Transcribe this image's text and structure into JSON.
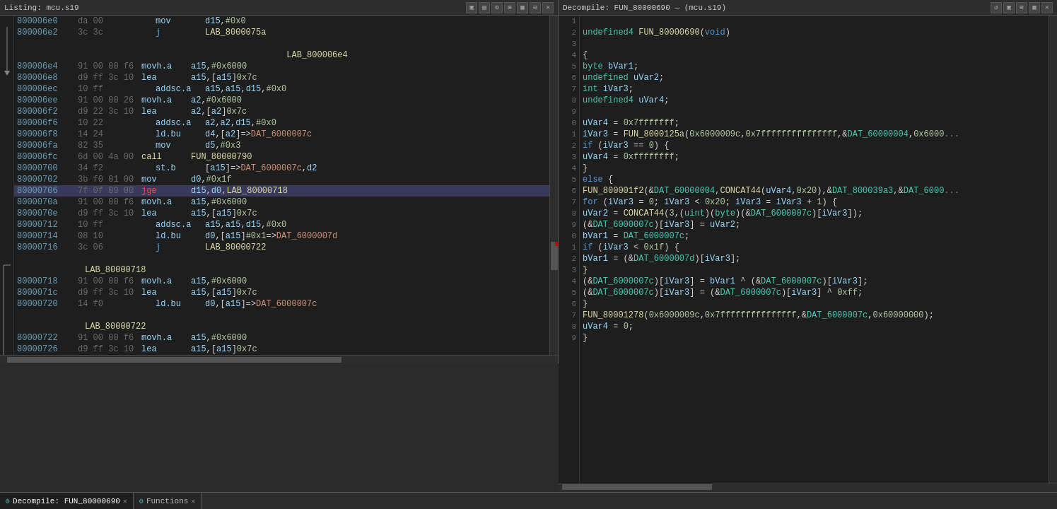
{
  "leftPanel": {
    "title": "Listing: mcu.s19",
    "lines": [
      {
        "addr": "800006e0",
        "bytes": "da 00",
        "mnem": "mov",
        "operands": "d15,#0x0",
        "type": "normal"
      },
      {
        "addr": "800006e2",
        "bytes": "3c 3c",
        "mnem": "j",
        "operands": "LAB_8000075a",
        "type": "normal"
      },
      {
        "label": "LAB_800006e4"
      },
      {
        "addr": "800006e4",
        "bytes": "91 00 00 f6",
        "mnem": "movh.a",
        "operands": "a15,#0x6000",
        "type": "normal"
      },
      {
        "addr": "800006e8",
        "bytes": "d9 ff 3c 10",
        "mnem": "lea",
        "operands": "a15,[a15]0x7c",
        "type": "normal"
      },
      {
        "addr": "800006ec",
        "bytes": "10 ff",
        "mnem": "addsc.a",
        "operands": "a15,a15,d15,#0x0",
        "type": "normal"
      },
      {
        "addr": "800006ee",
        "bytes": "91 00 00 26",
        "mnem": "movh.a",
        "operands": "a2,#0x6000",
        "type": "normal"
      },
      {
        "addr": "800006f2",
        "bytes": "d9 22 3c 10",
        "mnem": "lea",
        "operands": "a2,[a2]0x7c",
        "type": "normal"
      },
      {
        "addr": "800006f6",
        "bytes": "10 22",
        "mnem": "addsc.a",
        "operands": "a2,a2,d15,#0x0",
        "type": "normal"
      },
      {
        "addr": "800006f8",
        "bytes": "14 24",
        "mnem": "ld.bu",
        "operands": "d4,[a2]=>DAT_6000007c",
        "type": "normal"
      },
      {
        "addr": "800006fa",
        "bytes": "82 35",
        "mnem": "mov",
        "operands": "d5,#0x3",
        "type": "normal"
      },
      {
        "addr": "800006fc",
        "bytes": "6d 00 4a 00",
        "mnem": "call",
        "operands": "FUN_80000790",
        "type": "normal"
      },
      {
        "addr": "80000700",
        "bytes": "34 f2",
        "mnem": "st.b",
        "operands": "[a15]=>DAT_6000007c,d2",
        "type": "normal"
      },
      {
        "addr": "80000702",
        "bytes": "3b f0 01 00",
        "mnem": "mov",
        "operands": "d0,#0x1f",
        "type": "normal"
      },
      {
        "addr": "80000706",
        "bytes": "7f 0f 09 00",
        "mnem": "jge",
        "operands": "d15,d0,LAB_80000718",
        "type": "highlighted"
      },
      {
        "addr": "8000070a",
        "bytes": "91 00 00 f6",
        "mnem": "movh.a",
        "operands": "a15,#0x6000",
        "type": "normal"
      },
      {
        "addr": "8000070e",
        "bytes": "d9 ff 3c 10",
        "mnem": "lea",
        "operands": "a15,[a15]0x7c",
        "type": "normal"
      },
      {
        "addr": "80000712",
        "bytes": "10 ff",
        "mnem": "addsc.a",
        "operands": "a15,a15,d15,#0x0",
        "type": "normal"
      },
      {
        "addr": "80000714",
        "bytes": "08 10",
        "mnem": "ld.bu",
        "operands": "d0,[a15]#0x1=>DAT_6000007d",
        "type": "normal"
      },
      {
        "addr": "80000716",
        "bytes": "3c 06",
        "mnem": "j",
        "operands": "LAB_80000722",
        "type": "normal"
      },
      {
        "label": "LAB_80000718"
      },
      {
        "addr": "80000718",
        "bytes": "91 00 00 f6",
        "mnem": "movh.a",
        "operands": "a15,#0x6000",
        "type": "normal"
      },
      {
        "addr": "8000071c",
        "bytes": "d9 ff 3c 10",
        "mnem": "lea",
        "operands": "a15,[a15]0x7c",
        "type": "normal"
      },
      {
        "addr": "80000720",
        "bytes": "14 f0",
        "mnem": "ld.bu",
        "operands": "d0,[a15]=>DAT_6000007c",
        "type": "normal"
      },
      {
        "label": "LAB_80000722"
      },
      {
        "addr": "80000722",
        "bytes": "91 00 00 f6",
        "mnem": "movh.a",
        "operands": "a15,#0x6000",
        "type": "normal"
      },
      {
        "addr": "80000726",
        "bytes": "d9 ff 3c 10",
        "mnem": "lea",
        "operands": "a15,[a15]0x7c",
        "type": "normal"
      }
    ]
  },
  "rightPanel": {
    "title": "Decompile: FUN_80000690 — (mcu.s19)",
    "lines": [
      {
        "num": "1",
        "text": ""
      },
      {
        "num": "2",
        "text": "undefined4 FUN_80000690(void)"
      },
      {
        "num": "3",
        "text": ""
      },
      {
        "num": "4",
        "text": "{"
      },
      {
        "num": "5",
        "text": "  byte bVar1;"
      },
      {
        "num": "6",
        "text": "  undefined uVar2;"
      },
      {
        "num": "7",
        "text": "  int iVar3;"
      },
      {
        "num": "8",
        "text": "  undefined4 uVar4;"
      },
      {
        "num": "9",
        "text": ""
      },
      {
        "num": "0",
        "text": "  uVar4 = 0x7fffffff;"
      },
      {
        "num": "1",
        "text": "  iVar3 = FUN_8000125a(0x6000009c,0x7fffffffffffffff,&DAT_60000004,0x6000"
      },
      {
        "num": "2",
        "text": "  if (iVar3 == 0) {"
      },
      {
        "num": "3",
        "text": "    uVar4 = 0xffffffff;"
      },
      {
        "num": "4",
        "text": "  }"
      },
      {
        "num": "5",
        "text": "  else {"
      },
      {
        "num": "6",
        "text": "    FUN_800001f2(&DAT_60000004,CONCAT44(uVar4,0x20),&DAT_800039a3,&DAT_6000"
      },
      {
        "num": "7",
        "text": "    for (iVar3 = 0; iVar3 < 0x20; iVar3 = iVar3 + 1) {"
      },
      {
        "num": "8",
        "text": "      uVar2 = CONCAT44(3,(uint)(byte)(&DAT_6000007c)[iVar3]);"
      },
      {
        "num": "9",
        "text": "      (&DAT_6000007c)[iVar3] = uVar2;"
      },
      {
        "num": "0",
        "text": "      bVar1 = DAT_6000007c;"
      },
      {
        "num": "1",
        "text": "      if (iVar3 < 0x1f) {"
      },
      {
        "num": "2",
        "text": "        bVar1 = (&DAT_6000007d)[iVar3];"
      },
      {
        "num": "3",
        "text": "      }"
      },
      {
        "num": "4",
        "text": "      (&DAT_6000007c)[iVar3] = bVar1 ^ (&DAT_6000007c)[iVar3];"
      },
      {
        "num": "5",
        "text": "      (&DAT_6000007c)[iVar3] = (&DAT_6000007c)[iVar3] ^ 0xff;"
      },
      {
        "num": "6",
        "text": "    }"
      },
      {
        "num": "7",
        "text": "    FUN_80001278(0x6000009c,0x7fffffffffffffff,&DAT_6000007c,0x60000000);"
      },
      {
        "num": "8",
        "text": "    uVar4 = 0;"
      },
      {
        "num": "9",
        "text": "  }"
      }
    ]
  },
  "bottomTabs": {
    "tabs": [
      {
        "label": "Decompile: FUN_80000690",
        "icon": "decompile-icon",
        "active": true
      },
      {
        "label": "Functions",
        "icon": "functions-icon",
        "active": false
      }
    ]
  }
}
